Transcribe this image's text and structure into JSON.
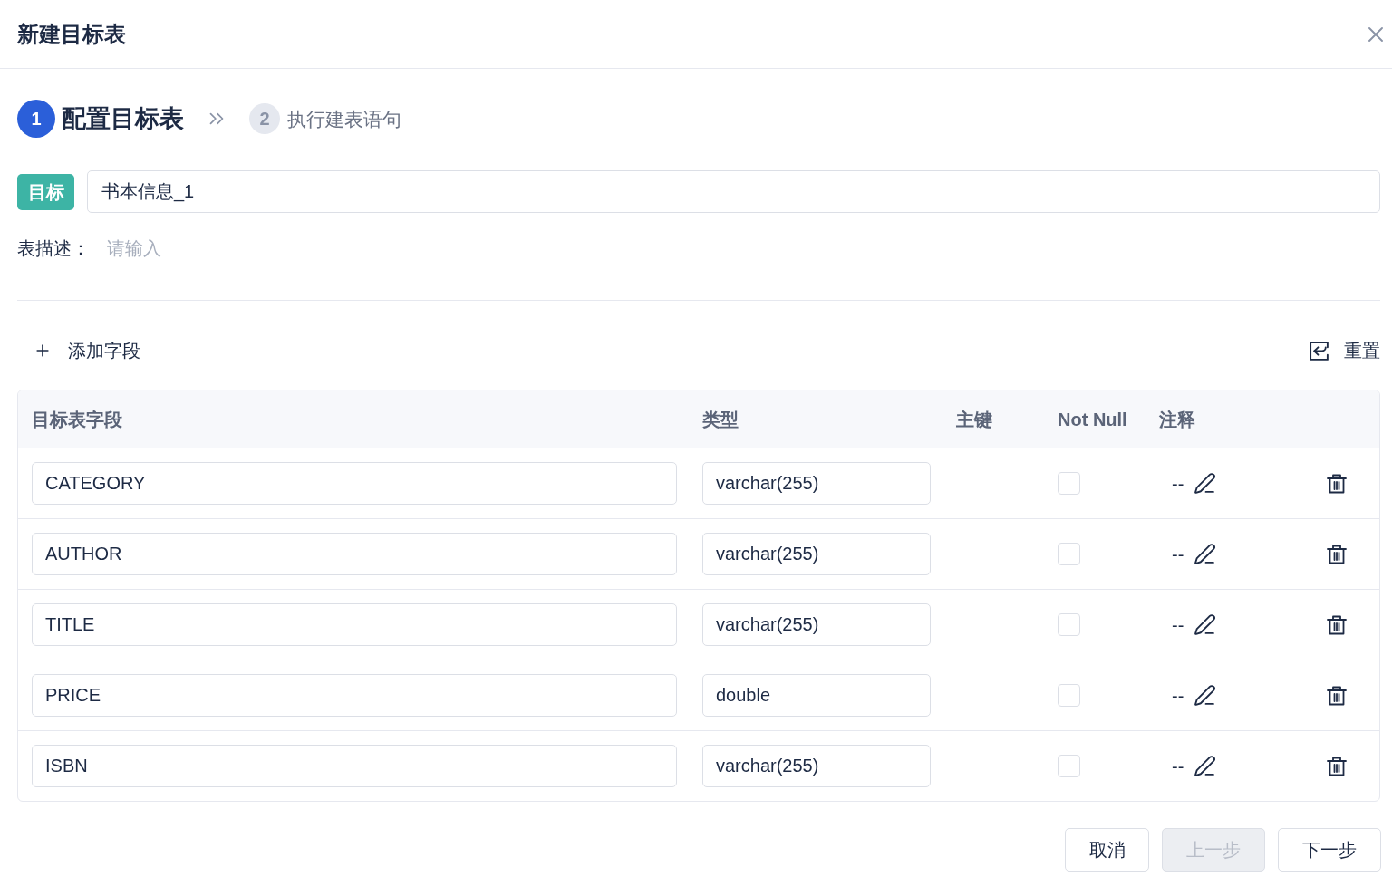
{
  "dialog": {
    "title": "新建目标表"
  },
  "steps": [
    {
      "number": "1",
      "label": "配置目标表",
      "selected": true
    },
    {
      "number": "2",
      "label": "执行建表语句",
      "selected": false
    }
  ],
  "target": {
    "badge": "目标",
    "value": "书本信息_1"
  },
  "description": {
    "label": "表描述：",
    "placeholder": "请输入"
  },
  "toolbar": {
    "add_label": "添加字段",
    "reset_label": "重置"
  },
  "table": {
    "columns": [
      "目标表字段",
      "类型",
      "主键",
      "Not Null",
      "注释"
    ],
    "rows": [
      {
        "field": "CATEGORY",
        "type": "varchar(255)",
        "not_null": false,
        "comment": "--"
      },
      {
        "field": "AUTHOR",
        "type": "varchar(255)",
        "not_null": false,
        "comment": "--"
      },
      {
        "field": "TITLE",
        "type": "varchar(255)",
        "not_null": false,
        "comment": "--"
      },
      {
        "field": "PRICE",
        "type": "double",
        "not_null": false,
        "comment": "--"
      },
      {
        "field": "ISBN",
        "type": "varchar(255)",
        "not_null": false,
        "comment": "--"
      }
    ]
  },
  "buttons": [
    {
      "label": "取消",
      "disabled": false
    },
    {
      "label": "上一步",
      "disabled": true
    },
    {
      "label": "下一步",
      "disabled": false
    }
  ]
}
